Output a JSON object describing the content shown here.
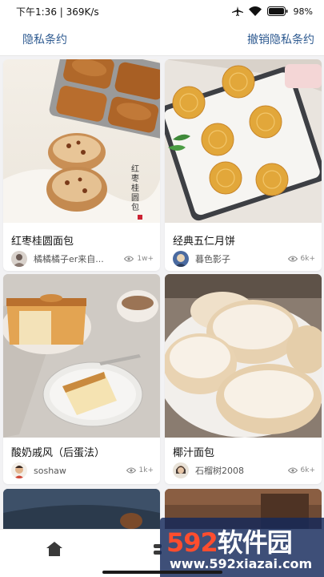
{
  "status_bar": {
    "time_speed": "下午1:36 | 369K/s",
    "battery_percent": "98%"
  },
  "header": {
    "privacy_link": "隐私条约",
    "revoke_link": "撤销隐私条约"
  },
  "cards": [
    {
      "title": "红枣桂圆面包",
      "author": "橘橘橘子er来自...",
      "views": "1w+",
      "photo": "bread-in-molds-photo",
      "photo_caption": "红枣桂圆包"
    },
    {
      "title": "经典五仁月饼",
      "author": "暮色影子",
      "views": "6k+",
      "photo": "mooncakes-photo"
    },
    {
      "title": "酸奶戚风（后蛋法）",
      "author": "soshaw",
      "views": "1k+",
      "photo": "chiffon-cake-photo"
    },
    {
      "title": "椰汁面包",
      "author": "石榴树2008",
      "views": "6k+",
      "photo": "coconut-buns-photo"
    }
  ],
  "watermark": {
    "main_digits": "592",
    "main_text": "软件园",
    "url": "www.592xiazai.com"
  },
  "colors": {
    "link": "#2f5b91",
    "background": "#f2f2f4",
    "watermark_bg": "#142a5a",
    "watermark_accent": "#ff4d2e"
  }
}
